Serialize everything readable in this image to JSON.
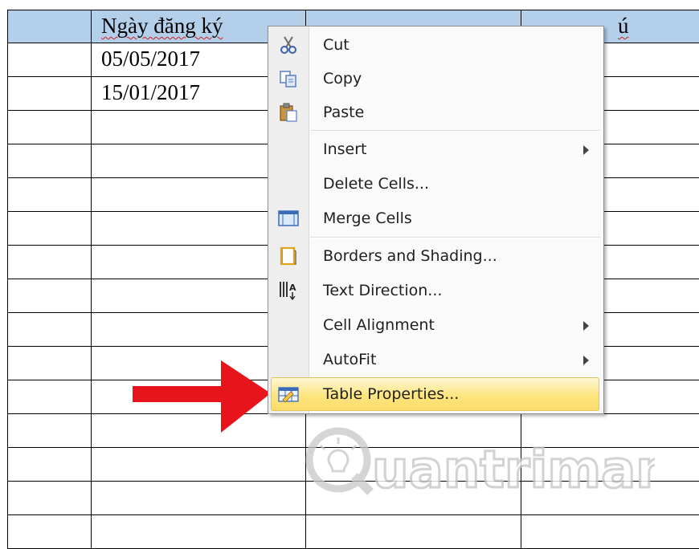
{
  "table": {
    "header": [
      "",
      "Ngày đăng ký",
      "",
      "ú"
    ],
    "rows": [
      [
        "05/05/2017"
      ],
      [
        "15/01/2017"
      ]
    ]
  },
  "context_menu": {
    "items": [
      {
        "label": "Cut",
        "icon": "scissors-icon"
      },
      {
        "label": "Copy",
        "icon": "copy-icon"
      },
      {
        "label": "Paste",
        "icon": "paste-icon"
      },
      {
        "label": "Insert",
        "submenu": true
      },
      {
        "label": "Delete Cells..."
      },
      {
        "label": "Merge Cells",
        "icon": "merge-cells-icon"
      },
      {
        "label": "Borders and Shading...",
        "icon": "borders-icon"
      },
      {
        "label": "Text Direction...",
        "icon": "text-direction-icon"
      },
      {
        "label": "Cell Alignment",
        "submenu": true
      },
      {
        "label": "AutoFit",
        "submenu": true
      },
      {
        "label": "Table Properties...",
        "icon": "table-properties-icon",
        "highlighted": true
      }
    ]
  },
  "watermark": {
    "text": "uantrimang"
  },
  "colors": {
    "header_fill": "#b4cfea",
    "highlight": "#fde57e",
    "arrow": "#e8141b"
  }
}
